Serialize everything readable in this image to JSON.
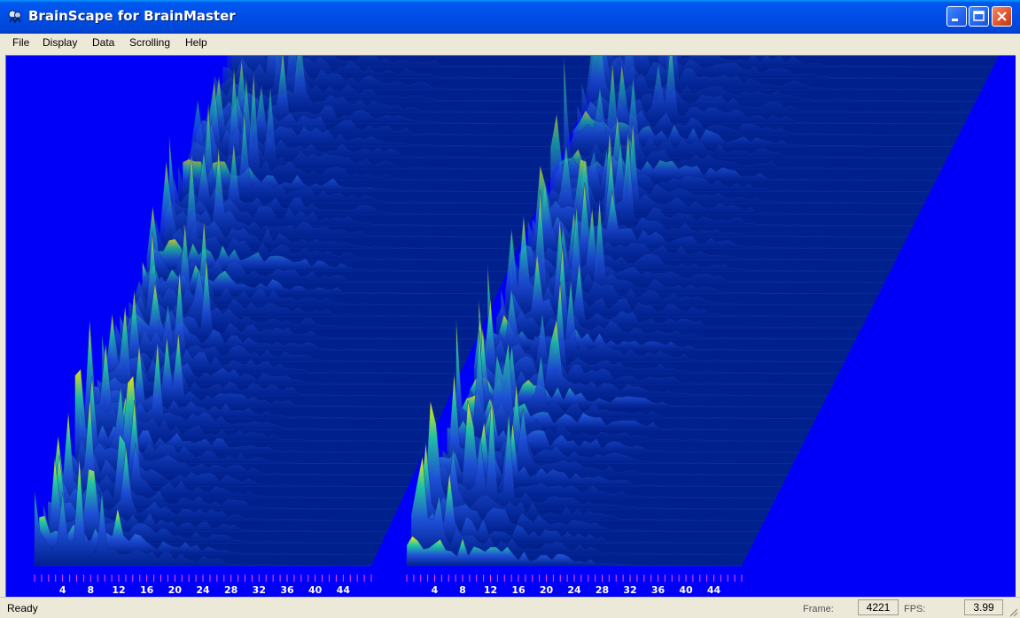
{
  "window": {
    "title": "BrainScape for BrainMaster",
    "icons": {
      "app": "brainscape-app-icon",
      "minimize": "minimize-icon",
      "maximize": "maximize-icon",
      "close": "close-icon"
    }
  },
  "menu": {
    "items": [
      {
        "label": "File"
      },
      {
        "label": "Display"
      },
      {
        "label": "Data"
      },
      {
        "label": "Scrolling"
      },
      {
        "label": "Help"
      }
    ]
  },
  "spectrogram": {
    "colors": {
      "background": "#0000f8",
      "floor": "#00208e",
      "peak_low": "#1f50d8",
      "peak_mid": "#23c8a0",
      "peak_high": "#fff000",
      "tick": "#ff44ff",
      "label": "#ffffff"
    },
    "panels": [
      {
        "name": "left",
        "axis_labels": [
          "4",
          "8",
          "12",
          "16",
          "20",
          "24",
          "28",
          "32",
          "36",
          "40",
          "44"
        ]
      },
      {
        "name": "right",
        "axis_labels": [
          "4",
          "8",
          "12",
          "16",
          "20",
          "24",
          "28",
          "32",
          "36",
          "40",
          "44"
        ]
      }
    ]
  },
  "status": {
    "text": "Ready",
    "frame_label": "Frame:",
    "frame_value": "4221",
    "fps_label": "FPS:",
    "fps_value": "3.99"
  }
}
